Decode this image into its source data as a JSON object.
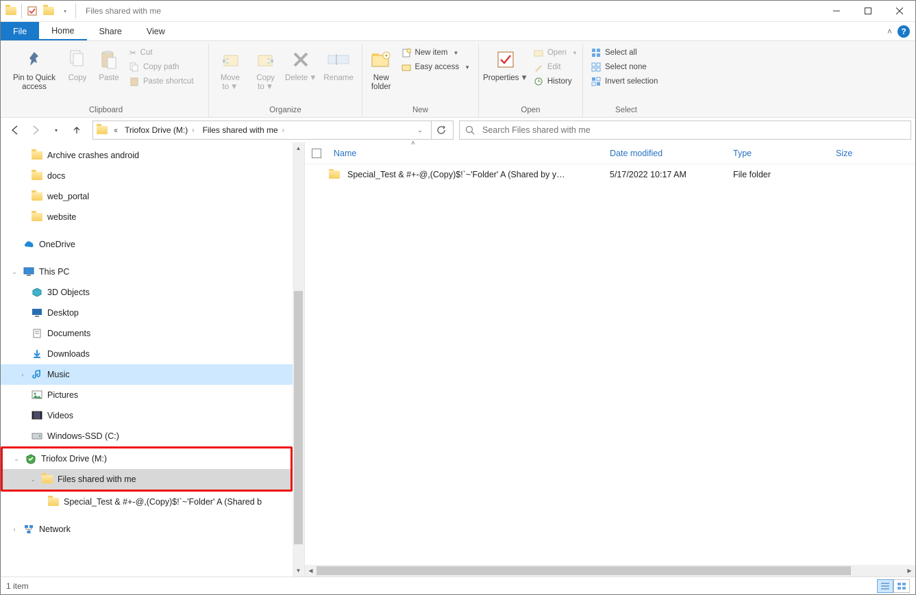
{
  "window": {
    "title": "Files shared with me"
  },
  "tabs": {
    "file": "File",
    "home": "Home",
    "share": "Share",
    "view": "View"
  },
  "ribbon": {
    "clipboard": {
      "label": "Clipboard",
      "pin": "Pin to Quick access",
      "copy": "Copy",
      "paste": "Paste",
      "cut": "Cut",
      "copypath": "Copy path",
      "pasteshortcut": "Paste shortcut"
    },
    "organize": {
      "label": "Organize",
      "moveto": "Move to",
      "copyto": "Copy to",
      "delete": "Delete",
      "rename": "Rename"
    },
    "new": {
      "label": "New",
      "newfolder": "New folder",
      "newitem": "New item",
      "easyaccess": "Easy access"
    },
    "open": {
      "label": "Open",
      "properties": "Properties",
      "open": "Open",
      "edit": "Edit",
      "history": "History"
    },
    "select": {
      "label": "Select",
      "all": "Select all",
      "none": "Select none",
      "invert": "Invert selection"
    }
  },
  "breadcrumb": {
    "seg1": "Triofox Drive (M:)",
    "seg2": "Files shared with me"
  },
  "search": {
    "placeholder": "Search Files shared with me"
  },
  "tree": {
    "items": [
      {
        "indent": 40,
        "twist": "",
        "icon": "folder",
        "label": "Archive crashes android"
      },
      {
        "indent": 40,
        "twist": "",
        "icon": "folder",
        "label": "docs"
      },
      {
        "indent": 40,
        "twist": "",
        "icon": "folder",
        "label": "web_portal"
      },
      {
        "indent": 40,
        "twist": "",
        "icon": "folder",
        "label": "website"
      },
      {
        "indent": 28,
        "twist": "",
        "icon": "onedrive",
        "label": "OneDrive",
        "gapTop": 10
      },
      {
        "indent": 28,
        "twist": "v",
        "icon": "thispc",
        "label": "This PC",
        "gapTop": 10
      },
      {
        "indent": 40,
        "twist": "",
        "icon": "3d",
        "label": "3D Objects"
      },
      {
        "indent": 40,
        "twist": "",
        "icon": "desktop",
        "label": "Desktop"
      },
      {
        "indent": 40,
        "twist": "",
        "icon": "documents",
        "label": "Documents"
      },
      {
        "indent": 40,
        "twist": "",
        "icon": "downloads",
        "label": "Downloads"
      },
      {
        "indent": 40,
        "twist": ">",
        "icon": "music",
        "label": "Music",
        "highlight": true
      },
      {
        "indent": 40,
        "twist": "",
        "icon": "pictures",
        "label": "Pictures"
      },
      {
        "indent": 40,
        "twist": "",
        "icon": "videos",
        "label": "Videos"
      },
      {
        "indent": 40,
        "twist": "",
        "icon": "disk",
        "label": "Windows-SSD (C:)"
      }
    ],
    "boxed": [
      {
        "indent": 28,
        "twist": "v",
        "icon": "triofox",
        "label": "Triofox Drive (M:)"
      },
      {
        "indent": 52,
        "twist": "v",
        "icon": "folder",
        "label": "Files shared with me",
        "selected": true
      }
    ],
    "after": [
      {
        "indent": 64,
        "twist": "",
        "icon": "folder",
        "label": "Special_Test & #+-@,(Copy)$!`~'Folder' A (Shared b"
      },
      {
        "indent": 28,
        "twist": ">",
        "icon": "network",
        "label": "Network",
        "gapTop": 10
      }
    ]
  },
  "columns": {
    "name": "Name",
    "date": "Date modified",
    "type": "Type",
    "size": "Size"
  },
  "files": [
    {
      "name": "Special_Test & #+-@,(Copy)$!`~'Folder' A (Shared by y…",
      "date": "5/17/2022 10:17 AM",
      "type": "File folder"
    }
  ],
  "status": {
    "text": "1 item"
  }
}
